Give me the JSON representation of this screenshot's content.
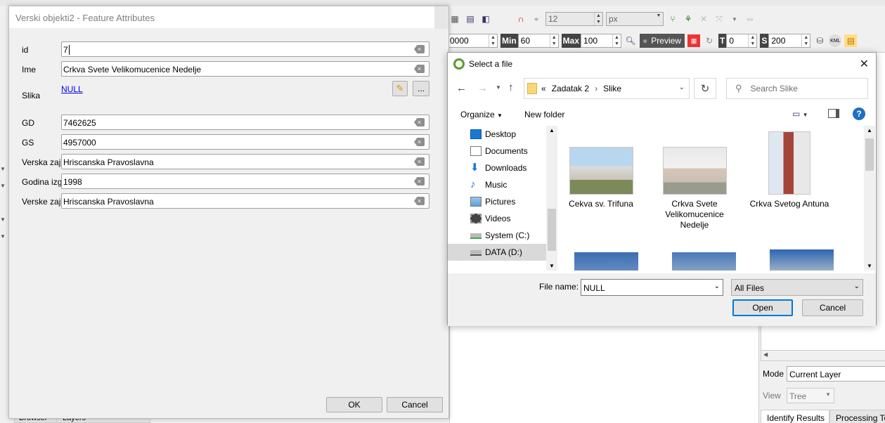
{
  "background": {
    "toolbar": {
      "font_size": "12",
      "unit": "px",
      "field_0000": "0000",
      "min_label": "Min",
      "min_value": "60",
      "max_label": "Max",
      "max_value": "100",
      "preview_label": "Preview",
      "t_label": "T",
      "t_value": "0",
      "s_label": "S",
      "s_value": "200"
    },
    "right_panel": {
      "mode_label": "Mode",
      "mode_value": "Current Layer",
      "view_label": "View",
      "view_value": "Tree",
      "tabs": [
        "Identify Results",
        "Processing Too"
      ]
    },
    "bottom_tabs": [
      "Browser",
      "Layers"
    ]
  },
  "feature_dialog": {
    "title": "Verski objekti2 - Feature Attributes",
    "fields": [
      {
        "label": "id",
        "value": "7"
      },
      {
        "label": "Ime",
        "value": "Crkva Svete Velikomucenice Nedelje"
      },
      {
        "label": "GD",
        "value": "7462625"
      },
      {
        "label": "GS",
        "value": "4957000"
      },
      {
        "label": "Verska zaj",
        "value": "Hriscanska Pravoslavna"
      },
      {
        "label": "Godina izg",
        "value": "1998"
      },
      {
        "label": "Verske zaj",
        "value": "Hriscanska Pravoslavna"
      }
    ],
    "slika_label": "Slika",
    "slika_value": "NULL",
    "browse_label": "...",
    "ok_label": "OK",
    "cancel_label": "Cancel"
  },
  "file_dialog": {
    "title": "Select a file",
    "breadcrumb": [
      "«",
      "Zadatak 2",
      "Slike"
    ],
    "search_placeholder": "Search Slike",
    "organize_label": "Organize",
    "new_folder_label": "New folder",
    "tree": [
      {
        "label": "Desktop",
        "icon": "desktop-icon"
      },
      {
        "label": "Documents",
        "icon": "documents-icon"
      },
      {
        "label": "Downloads",
        "icon": "downloads-icon"
      },
      {
        "label": "Music",
        "icon": "music-icon"
      },
      {
        "label": "Pictures",
        "icon": "pictures-icon"
      },
      {
        "label": "Videos",
        "icon": "videos-icon"
      },
      {
        "label": "System (C:)",
        "icon": "drive-icon"
      },
      {
        "label": "DATA (D:)",
        "icon": "drive-icon"
      }
    ],
    "files": [
      {
        "name": "Cekva sv. Trifuna"
      },
      {
        "name": "Crkva Svete Velikomucenice Nedelje"
      },
      {
        "name": "Crkva Svetog Antuna"
      }
    ],
    "file_name_label": "File name:",
    "file_name_value": "NULL",
    "filter_value": "All Files",
    "open_label": "Open",
    "cancel_label": "Cancel"
  }
}
